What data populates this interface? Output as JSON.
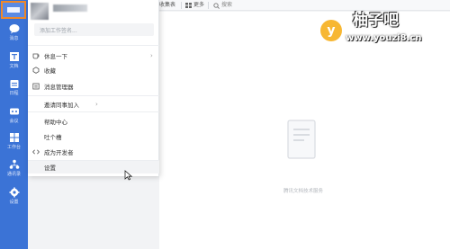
{
  "rail": {
    "items": [
      {
        "label": "消息",
        "icon": "chat-icon"
      },
      {
        "label": "文档",
        "icon": "document-icon"
      },
      {
        "label": "日程",
        "icon": "calendar-icon"
      },
      {
        "label": "会议",
        "icon": "meeting-icon"
      },
      {
        "label": "工作台",
        "icon": "apps-icon"
      },
      {
        "label": "通讯录",
        "icon": "contacts-icon"
      },
      {
        "label": "设置",
        "icon": "gear-icon"
      }
    ]
  },
  "panel": {
    "status_placeholder": "添加工作签名...",
    "menu": [
      {
        "label": "休息一下",
        "icon": "coffee-icon",
        "chevron": "›"
      },
      {
        "label": "收藏",
        "icon": "bookmark-icon",
        "chevron": ""
      },
      {
        "label": "消息管理器",
        "icon": "message-manager-icon",
        "chevron": ""
      },
      {
        "label": "邀请同事加入",
        "icon": "",
        "chevron": "›"
      },
      {
        "label": "帮助中心",
        "icon": "",
        "chevron": ""
      },
      {
        "label": "吐个槽",
        "icon": "",
        "chevron": ""
      },
      {
        "label": "成为开发者",
        "icon": "code-icon",
        "chevron": ""
      },
      {
        "label": "设置",
        "icon": "",
        "chevron": ""
      }
    ]
  },
  "toolbar": {
    "favorites_label": "收集表",
    "more_label": "更多",
    "search_label": "搜索"
  },
  "main": {
    "empty_text": "腾讯文档技术服务"
  },
  "watermark": {
    "title": "柚子吧",
    "logo_letter": "y",
    "url": "www.youzi8.cn"
  },
  "colors": {
    "rail_blue": "#3b73d6",
    "accent_orange": "#f0892a",
    "watermark_yellow": "#f7b733"
  }
}
